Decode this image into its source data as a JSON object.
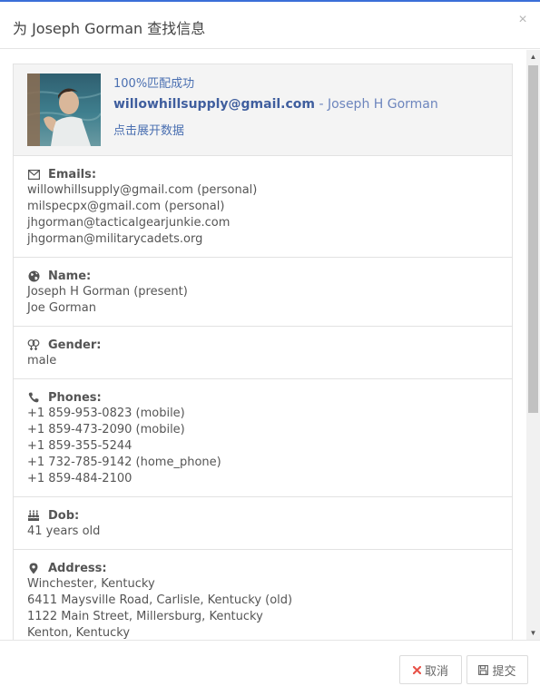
{
  "modal": {
    "title": "为 Joseph Gorman 查找信息",
    "close_symbol": "×"
  },
  "profile": {
    "match_text": "100%匹配成功",
    "email": "willowhillsupply@gmail.com",
    "separator": " - ",
    "person": "Joseph H Gorman",
    "expand_text": "点击展开数据"
  },
  "sections": {
    "emails": {
      "icon": "envelope-icon",
      "label": "Emails:",
      "lines": [
        "willowhillsupply@gmail.com (personal)",
        "milspecpx@gmail.com (personal)",
        "jhgorman@tacticalgearjunkie.com",
        "jhgorman@militarycadets.org"
      ]
    },
    "name": {
      "icon": "globe-icon",
      "label": "Name:",
      "lines": [
        "Joseph H Gorman (present)",
        "Joe Gorman"
      ]
    },
    "gender": {
      "icon": "gender-icon",
      "label": "Gender:",
      "lines": [
        "male"
      ]
    },
    "phones": {
      "icon": "phone-icon",
      "label": "Phones:",
      "lines": [
        "+1 859-953-0823 (mobile)",
        "+1 859-473-2090 (mobile)",
        "+1 859-355-5244",
        "+1 732-785-9142 (home_phone)",
        "+1 859-484-2100"
      ]
    },
    "dob": {
      "icon": "birthday-cake-icon",
      "label": "Dob:",
      "lines": [
        "41 years old"
      ]
    },
    "address": {
      "icon": "map-marker-icon",
      "label": "Address:",
      "lines": [
        "Winchester, Kentucky",
        "6411 Maysville Road, Carlisle, Kentucky (old)",
        "1122 Main Street, Millersburg, Kentucky",
        "Kenton, Kentucky"
      ]
    }
  },
  "footer": {
    "cancel_label": "取消",
    "submit_label": "提交"
  },
  "colors": {
    "accent": "#3b6fd8",
    "link": "#4a6fb1",
    "cancel_icon": "#e8544a"
  }
}
